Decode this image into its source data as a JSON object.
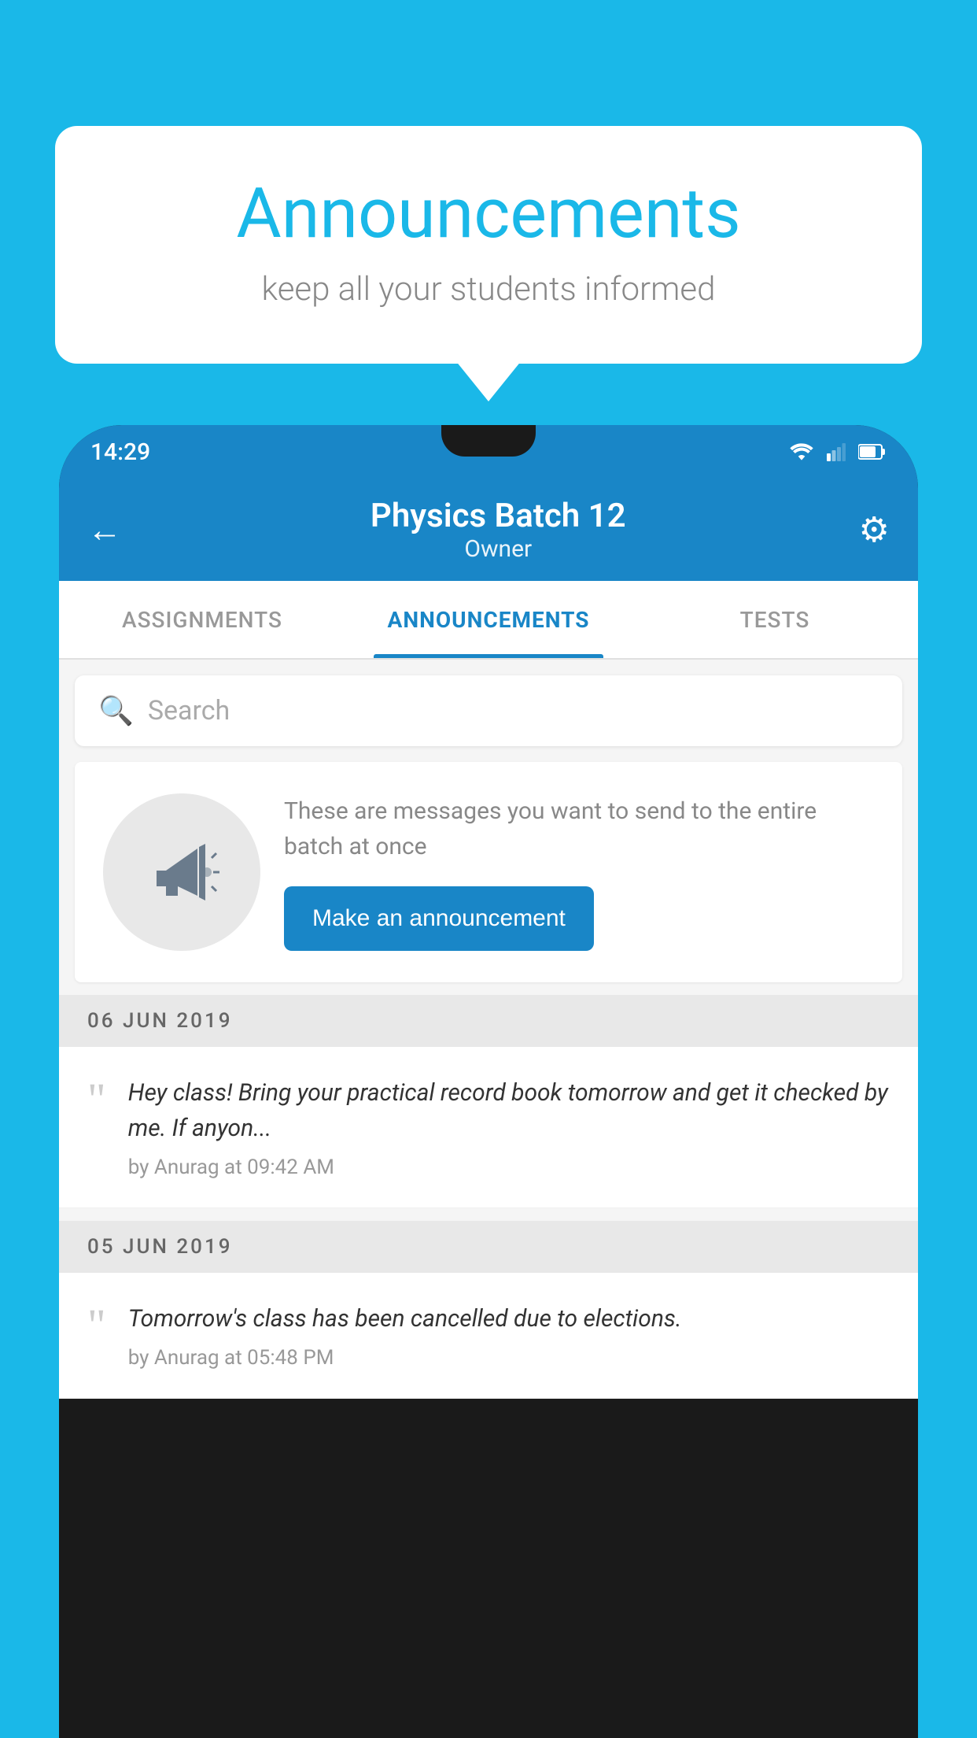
{
  "background": {
    "color": "#1ab8e8"
  },
  "speech_bubble": {
    "title": "Announcements",
    "subtitle": "keep all your students informed"
  },
  "phone": {
    "status_bar": {
      "time": "14:29"
    },
    "app_bar": {
      "title": "Physics Batch 12",
      "subtitle": "Owner",
      "back_label": "←",
      "settings_label": "⚙"
    },
    "tabs": [
      {
        "label": "ASSIGNMENTS",
        "active": false
      },
      {
        "label": "ANNOUNCEMENTS",
        "active": true
      },
      {
        "label": "TESTS",
        "active": false
      },
      {
        "label": "•••",
        "active": false
      }
    ],
    "search": {
      "placeholder": "Search"
    },
    "announcement_prompt": {
      "description_text": "These are messages you want to send to the entire batch at once",
      "button_label": "Make an announcement"
    },
    "announcements": [
      {
        "date": "06  JUN  2019",
        "messages": [
          {
            "text": "Hey class! Bring your practical record book tomorrow and get it checked by me. If anyon...",
            "meta": "by Anurag at 09:42 AM"
          }
        ]
      },
      {
        "date": "05  JUN  2019",
        "messages": [
          {
            "text": "Tomorrow's class has been cancelled due to elections.",
            "meta": "by Anurag at 05:48 PM"
          }
        ]
      }
    ]
  }
}
